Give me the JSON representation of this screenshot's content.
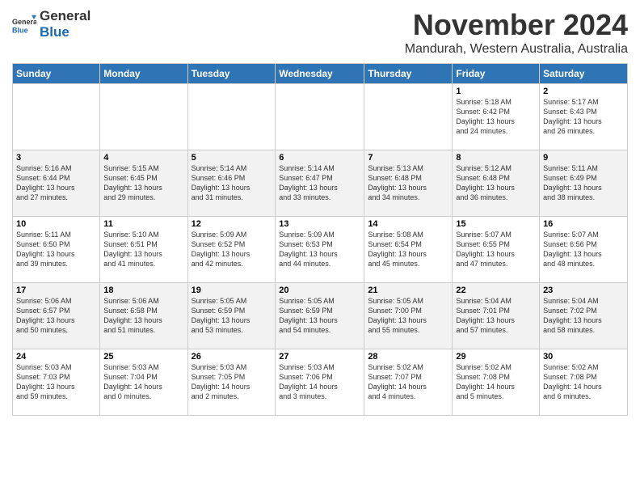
{
  "logo": {
    "general": "General",
    "blue": "Blue"
  },
  "header": {
    "month": "November 2024",
    "location": "Mandurah, Western Australia, Australia"
  },
  "weekdays": [
    "Sunday",
    "Monday",
    "Tuesday",
    "Wednesday",
    "Thursday",
    "Friday",
    "Saturday"
  ],
  "weeks": [
    [
      {
        "day": "",
        "info": ""
      },
      {
        "day": "",
        "info": ""
      },
      {
        "day": "",
        "info": ""
      },
      {
        "day": "",
        "info": ""
      },
      {
        "day": "",
        "info": ""
      },
      {
        "day": "1",
        "info": "Sunrise: 5:18 AM\nSunset: 6:42 PM\nDaylight: 13 hours\nand 24 minutes."
      },
      {
        "day": "2",
        "info": "Sunrise: 5:17 AM\nSunset: 6:43 PM\nDaylight: 13 hours\nand 26 minutes."
      }
    ],
    [
      {
        "day": "3",
        "info": "Sunrise: 5:16 AM\nSunset: 6:44 PM\nDaylight: 13 hours\nand 27 minutes."
      },
      {
        "day": "4",
        "info": "Sunrise: 5:15 AM\nSunset: 6:45 PM\nDaylight: 13 hours\nand 29 minutes."
      },
      {
        "day": "5",
        "info": "Sunrise: 5:14 AM\nSunset: 6:46 PM\nDaylight: 13 hours\nand 31 minutes."
      },
      {
        "day": "6",
        "info": "Sunrise: 5:14 AM\nSunset: 6:47 PM\nDaylight: 13 hours\nand 33 minutes."
      },
      {
        "day": "7",
        "info": "Sunrise: 5:13 AM\nSunset: 6:48 PM\nDaylight: 13 hours\nand 34 minutes."
      },
      {
        "day": "8",
        "info": "Sunrise: 5:12 AM\nSunset: 6:48 PM\nDaylight: 13 hours\nand 36 minutes."
      },
      {
        "day": "9",
        "info": "Sunrise: 5:11 AM\nSunset: 6:49 PM\nDaylight: 13 hours\nand 38 minutes."
      }
    ],
    [
      {
        "day": "10",
        "info": "Sunrise: 5:11 AM\nSunset: 6:50 PM\nDaylight: 13 hours\nand 39 minutes."
      },
      {
        "day": "11",
        "info": "Sunrise: 5:10 AM\nSunset: 6:51 PM\nDaylight: 13 hours\nand 41 minutes."
      },
      {
        "day": "12",
        "info": "Sunrise: 5:09 AM\nSunset: 6:52 PM\nDaylight: 13 hours\nand 42 minutes."
      },
      {
        "day": "13",
        "info": "Sunrise: 5:09 AM\nSunset: 6:53 PM\nDaylight: 13 hours\nand 44 minutes."
      },
      {
        "day": "14",
        "info": "Sunrise: 5:08 AM\nSunset: 6:54 PM\nDaylight: 13 hours\nand 45 minutes."
      },
      {
        "day": "15",
        "info": "Sunrise: 5:07 AM\nSunset: 6:55 PM\nDaylight: 13 hours\nand 47 minutes."
      },
      {
        "day": "16",
        "info": "Sunrise: 5:07 AM\nSunset: 6:56 PM\nDaylight: 13 hours\nand 48 minutes."
      }
    ],
    [
      {
        "day": "17",
        "info": "Sunrise: 5:06 AM\nSunset: 6:57 PM\nDaylight: 13 hours\nand 50 minutes."
      },
      {
        "day": "18",
        "info": "Sunrise: 5:06 AM\nSunset: 6:58 PM\nDaylight: 13 hours\nand 51 minutes."
      },
      {
        "day": "19",
        "info": "Sunrise: 5:05 AM\nSunset: 6:59 PM\nDaylight: 13 hours\nand 53 minutes."
      },
      {
        "day": "20",
        "info": "Sunrise: 5:05 AM\nSunset: 6:59 PM\nDaylight: 13 hours\nand 54 minutes."
      },
      {
        "day": "21",
        "info": "Sunrise: 5:05 AM\nSunset: 7:00 PM\nDaylight: 13 hours\nand 55 minutes."
      },
      {
        "day": "22",
        "info": "Sunrise: 5:04 AM\nSunset: 7:01 PM\nDaylight: 13 hours\nand 57 minutes."
      },
      {
        "day": "23",
        "info": "Sunrise: 5:04 AM\nSunset: 7:02 PM\nDaylight: 13 hours\nand 58 minutes."
      }
    ],
    [
      {
        "day": "24",
        "info": "Sunrise: 5:03 AM\nSunset: 7:03 PM\nDaylight: 13 hours\nand 59 minutes."
      },
      {
        "day": "25",
        "info": "Sunrise: 5:03 AM\nSunset: 7:04 PM\nDaylight: 14 hours\nand 0 minutes."
      },
      {
        "day": "26",
        "info": "Sunrise: 5:03 AM\nSunset: 7:05 PM\nDaylight: 14 hours\nand 2 minutes."
      },
      {
        "day": "27",
        "info": "Sunrise: 5:03 AM\nSunset: 7:06 PM\nDaylight: 14 hours\nand 3 minutes."
      },
      {
        "day": "28",
        "info": "Sunrise: 5:02 AM\nSunset: 7:07 PM\nDaylight: 14 hours\nand 4 minutes."
      },
      {
        "day": "29",
        "info": "Sunrise: 5:02 AM\nSunset: 7:08 PM\nDaylight: 14 hours\nand 5 minutes."
      },
      {
        "day": "30",
        "info": "Sunrise: 5:02 AM\nSunset: 7:08 PM\nDaylight: 14 hours\nand 6 minutes."
      }
    ]
  ]
}
